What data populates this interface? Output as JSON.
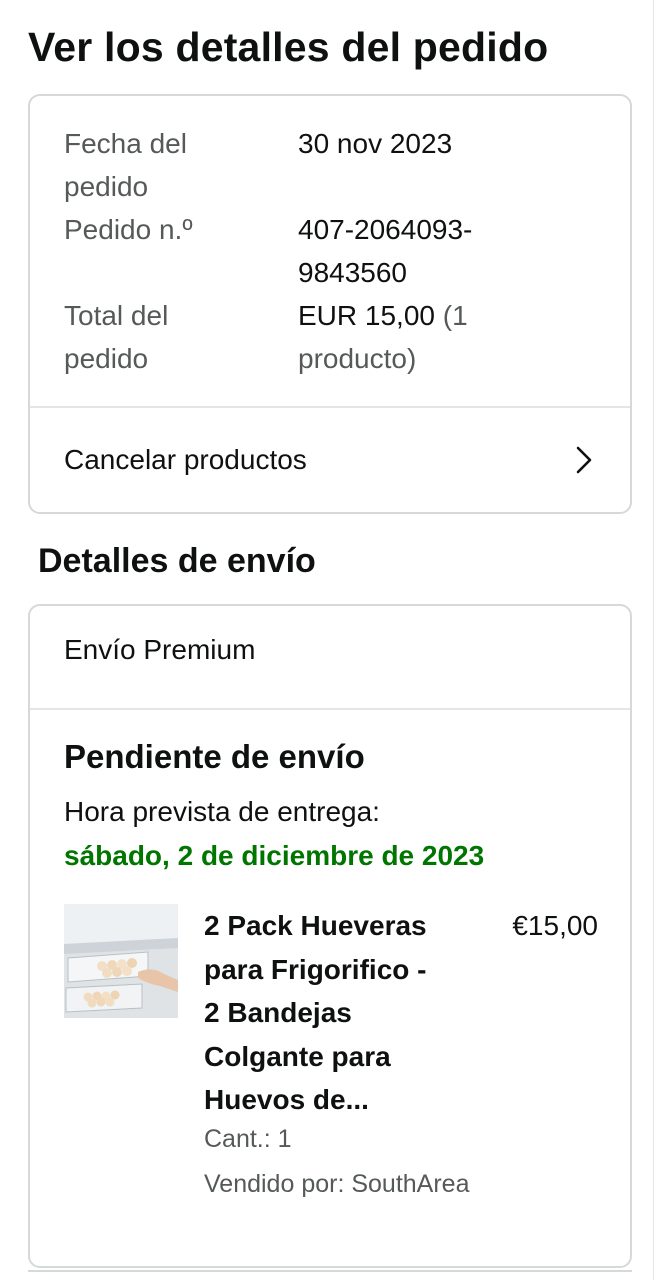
{
  "page": {
    "title": "Ver los detalles del pedido"
  },
  "order_summary": {
    "date_label_line1": "Fecha del",
    "date_label_line2": "pedido",
    "date_value": "30 nov 2023",
    "number_label": "Pedido n.º",
    "number_value_line1": "407-2064093-",
    "number_value_line2": "9843560",
    "total_label_line1": "Total del",
    "total_label_line2": "pedido",
    "total_amount": "EUR 15,00",
    "total_count_line1": " (1",
    "total_count_line2": "producto)",
    "cancel_label": "Cancelar productos",
    "cancel_icon": "chevron-right-icon"
  },
  "shipping": {
    "section_title": "Detalles de envío",
    "type": "Envío Premium",
    "status": "Pendiente de envío",
    "eta_label": "Hora prevista de entrega:",
    "eta_date": "sábado, 2 de diciembre de 2023",
    "eta_color": "#007600"
  },
  "product": {
    "image_icon": "egg-tray-fridge-photo",
    "title_lines": [
      "2 Pack Hueveras",
      "para Frigorifico -",
      "2 Bandejas",
      "Colgante para",
      "Huevos de..."
    ],
    "price": "€15,00",
    "quantity": "Cant.: 1",
    "seller": "Vendido por: SouthArea"
  }
}
